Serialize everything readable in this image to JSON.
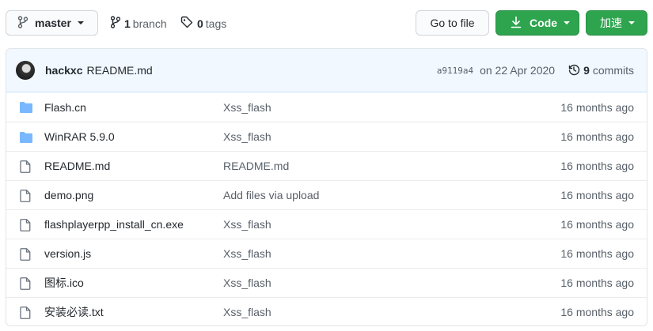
{
  "branch_selector": {
    "name": "master"
  },
  "branches": {
    "count": "1",
    "label": "branch"
  },
  "tags": {
    "count": "0",
    "label": "tags"
  },
  "actions": {
    "go_to_file": "Go to file",
    "code": "Code",
    "accelerate": "加速"
  },
  "commit": {
    "author": "hackxc",
    "message": "README.md",
    "sha": "a9119a4",
    "date": "on 22 Apr 2020",
    "count": "9",
    "count_label": "commits"
  },
  "files": [
    {
      "type": "folder",
      "name": "Flash.cn",
      "message": "Xss_flash",
      "age": "16 months ago"
    },
    {
      "type": "folder",
      "name": "WinRAR 5.9.0",
      "message": "Xss_flash",
      "age": "16 months ago"
    },
    {
      "type": "file",
      "name": "README.md",
      "message": "README.md",
      "age": "16 months ago"
    },
    {
      "type": "file",
      "name": "demo.png",
      "message": "Add files via upload",
      "age": "16 months ago"
    },
    {
      "type": "file",
      "name": "flashplayerpp_install_cn.exe",
      "message": "Xss_flash",
      "age": "16 months ago"
    },
    {
      "type": "file",
      "name": "version.js",
      "message": "Xss_flash",
      "age": "16 months ago"
    },
    {
      "type": "file",
      "name": "图标.ico",
      "message": "Xss_flash",
      "age": "16 months ago"
    },
    {
      "type": "file",
      "name": "安装必读.txt",
      "message": "Xss_flash",
      "age": "16 months ago"
    }
  ],
  "colors": {
    "primary_green": "#2ea44f",
    "folder_blue": "#79b8ff",
    "commit_bar_bg": "#f1f8ff",
    "muted_text": "#586069"
  }
}
